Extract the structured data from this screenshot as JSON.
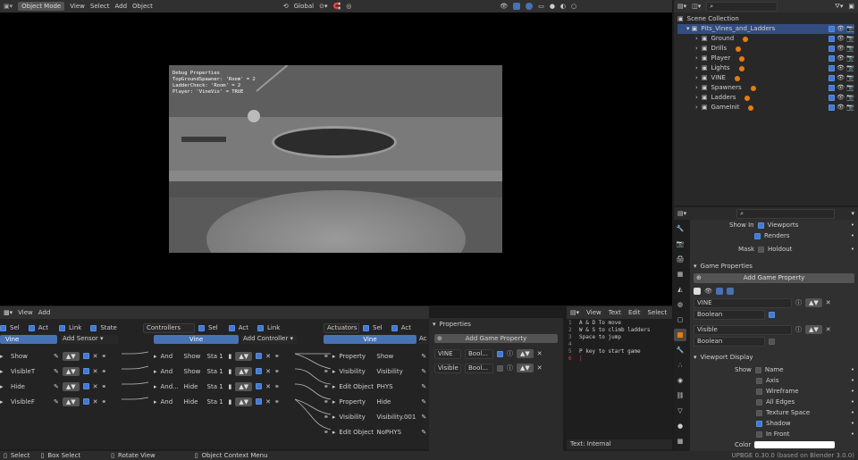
{
  "top_header": {
    "mode": "Object Mode",
    "menu": [
      "View",
      "Select",
      "Add",
      "Object"
    ],
    "transform": "Global"
  },
  "debug": {
    "title": "Debug Properties",
    "lines": [
      "TopGroundSpawner: 'Room' = 2",
      "LadderCheck: 'Room' = 2",
      "Player: 'VineVis' = TRUE"
    ]
  },
  "outliner": {
    "title": "Scene Collection",
    "collection": "Pits_Vines_and_Ladders",
    "items": [
      "Ground",
      "Drills",
      "Player",
      "Lights",
      "VINE",
      "Spawners",
      "Ladders",
      "GameInit"
    ]
  },
  "props": {
    "show_in": "Show In",
    "viewports": "Viewports",
    "renders": "Renders",
    "mask": "Mask",
    "holdout": "Holdout",
    "game_props_title": "Game Properties",
    "add_game_prop": "Add Game Property",
    "prop1_name": "VINE",
    "prop1_type": "Boolean",
    "prop2_name": "Visible",
    "prop2_type": "Boolean",
    "viewport_display_title": "Viewport Display",
    "show": "Show",
    "show_items": [
      "Name",
      "Axis",
      "Wireframe",
      "All Edges",
      "Texture Space",
      "Shadow",
      "In Front"
    ],
    "color": "Color"
  },
  "logic": {
    "menu": [
      "View",
      "Add"
    ],
    "sensors": {
      "sel": "Sel",
      "act": "Act",
      "link": "Link",
      "state": "State",
      "obj": "Vine",
      "add": "Add Sensor",
      "rows": [
        "Show",
        "VisibleT",
        "Hide",
        "VisibleF"
      ]
    },
    "controllers": {
      "title": "Controllers",
      "sel": "Sel",
      "act": "Act",
      "link": "Link",
      "obj": "Vine",
      "add": "Add Controller",
      "rows": [
        {
          "type": "And",
          "name": "Show",
          "state": "Sta 1"
        },
        {
          "type": "And",
          "name": "Show",
          "state": "Sta 1"
        },
        {
          "type": "And...",
          "name": "Hide",
          "state": "Sta 1"
        },
        {
          "type": "And",
          "name": "Hide",
          "state": "Sta 1"
        }
      ]
    },
    "actuators": {
      "title": "Actuators",
      "sel": "Sel",
      "act": "Act",
      "obj": "Vine",
      "add": "Ac",
      "rows": [
        {
          "type": "Property",
          "name": "Show"
        },
        {
          "type": "Visibility",
          "name": "Visibility"
        },
        {
          "type": "Edit Object",
          "name": "PHYS"
        },
        {
          "type": "Property",
          "name": "Hide"
        },
        {
          "type": "Visibility",
          "name": "Visibility.001"
        },
        {
          "type": "Edit Object",
          "name": "NoPHYS"
        }
      ]
    }
  },
  "logic_props": {
    "title": "Properties",
    "add": "Add Game Property",
    "p1": {
      "name": "VINE",
      "type": "Bool..."
    },
    "p2": {
      "name": "Visible",
      "type": "Bool..."
    }
  },
  "text_editor": {
    "menu": [
      "View",
      "Text",
      "Edit",
      "Select"
    ],
    "lines": [
      "A & D To move",
      "W & S to climb ladders",
      "Space to jump",
      "",
      "P key to start game",
      ""
    ],
    "footer": "Text: Internal"
  },
  "status": {
    "select": "Select",
    "box": "Box Select",
    "rotate": "Rotate View",
    "context": "Object Context Menu",
    "version": "UPBGE 0.30.0 (based on Blender 3.0.0)"
  },
  "colors": {
    "accent": "#4772b3",
    "orange": "#e87d0d"
  }
}
